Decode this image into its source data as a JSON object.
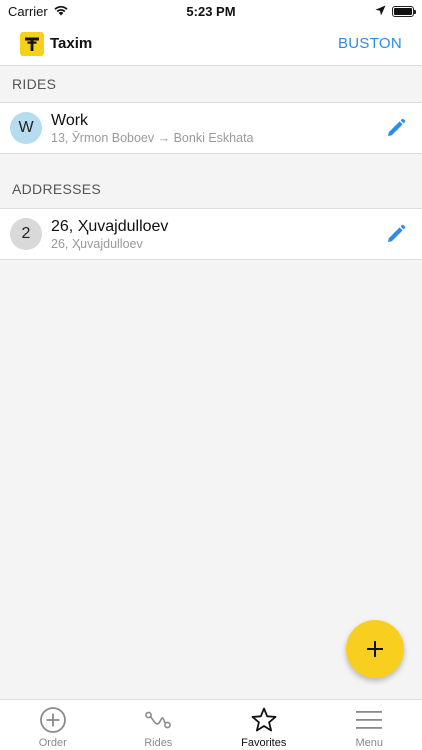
{
  "status_bar": {
    "carrier": "Carrier",
    "time": "5:23 PM"
  },
  "header": {
    "brand_name": "Taxim",
    "city": "BUSTON"
  },
  "rides_section": {
    "title": "RIDES",
    "items": [
      {
        "badge": "W",
        "title": "Work",
        "subtitle": "13, Ӯrmon Boboev → Bonki Eskhata"
      }
    ]
  },
  "addresses_section": {
    "title": "ADDRESSES",
    "items": [
      {
        "badge": "2",
        "title": "26, Ҳuvajdulloev",
        "subtitle": "26, Ҳuvajdulloev"
      }
    ]
  },
  "tabs": [
    {
      "label": "Order",
      "icon": "plus-circle-icon"
    },
    {
      "label": "Rides",
      "icon": "route-icon"
    },
    {
      "label": "Favorites",
      "icon": "star-icon",
      "active": true
    },
    {
      "label": "Menu",
      "icon": "menu-icon"
    }
  ],
  "colors": {
    "accent_blue": "#2d8ce8",
    "brand_yellow": "#f9cf1f",
    "ride_badge_bg": "#b5dcef",
    "address_badge_bg": "#d9d9d9"
  }
}
